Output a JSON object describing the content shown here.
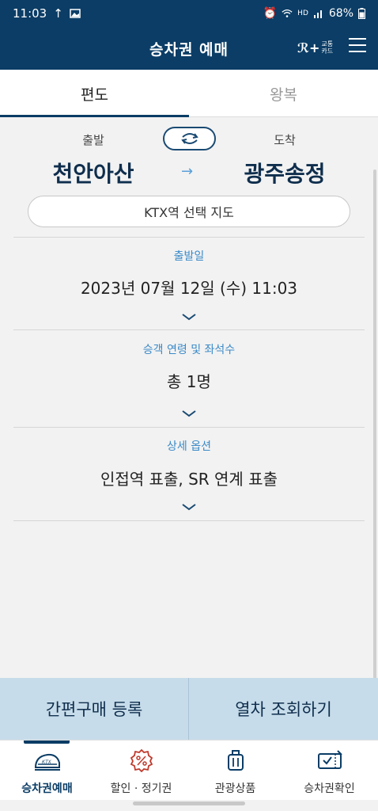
{
  "status": {
    "time": "11:03",
    "battery": "68%",
    "hd": "HD"
  },
  "header": {
    "title": "승차권 예매",
    "card_logo_text": "교통 카드"
  },
  "tabs": [
    {
      "label": "편도"
    },
    {
      "label": "왕복"
    }
  ],
  "route": {
    "origin_label": "출발",
    "dest_label": "도착",
    "origin": "천안아산",
    "destination": "광주송정",
    "arrow": "→",
    "map_button": "KTX역 선택 지도"
  },
  "sections": {
    "date": {
      "label": "출발일",
      "value": "2023년 07월 12일 (수) 11:03"
    },
    "passengers": {
      "label": "승객 연령 및 좌석수",
      "value": "총 1명"
    },
    "options": {
      "label": "상세 옵션",
      "value": "인접역 표출, SR 연계 표출"
    }
  },
  "actions": {
    "quick_register": "간편구매 등록",
    "search_trains": "열차 조회하기"
  },
  "nav": [
    {
      "label": "승차권예매",
      "icon": "ktx-train-icon"
    },
    {
      "label": "할인 · 정기권",
      "icon": "discount-icon"
    },
    {
      "label": "관광상품",
      "icon": "luggage-icon"
    },
    {
      "label": "승차권확인",
      "icon": "ticket-check-icon"
    }
  ],
  "colors": {
    "primary": "#0b3d66",
    "accent": "#3a8ac8",
    "action_bar": "#c7dcea"
  }
}
